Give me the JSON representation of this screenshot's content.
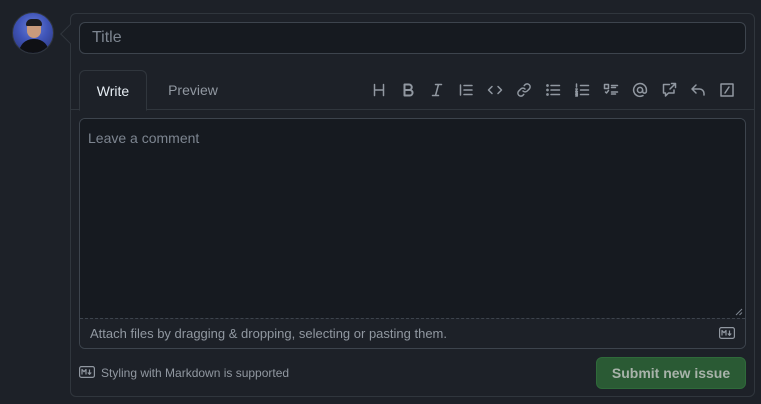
{
  "issue_form": {
    "title_placeholder": "Title",
    "tabs": [
      {
        "label": "Write",
        "active": true
      },
      {
        "label": "Preview",
        "active": false
      }
    ],
    "toolbar": [
      {
        "icon": "heading-icon"
      },
      {
        "icon": "bold-icon"
      },
      {
        "icon": "italic-icon"
      },
      {
        "icon": "quote-icon"
      },
      {
        "icon": "code-icon"
      },
      {
        "icon": "link-icon"
      },
      {
        "icon": "unordered-list-icon"
      },
      {
        "icon": "ordered-list-icon"
      },
      {
        "icon": "task-list-icon"
      },
      {
        "icon": "mention-icon"
      },
      {
        "icon": "cross-reference-icon"
      },
      {
        "icon": "saved-reply-icon"
      },
      {
        "icon": "slash-command-icon"
      }
    ],
    "comment_placeholder": "Leave a comment",
    "attach_text": "Attach files by dragging & dropping, selecting or pasting them.",
    "markdown_note": "Styling with Markdown is supported",
    "submit_label": "Submit new issue"
  },
  "colors": {
    "background": "#1d2128",
    "input_background": "#161a20",
    "border": "#30363d",
    "muted_text": "#9198a1",
    "submit_background": "#2a5a34"
  }
}
